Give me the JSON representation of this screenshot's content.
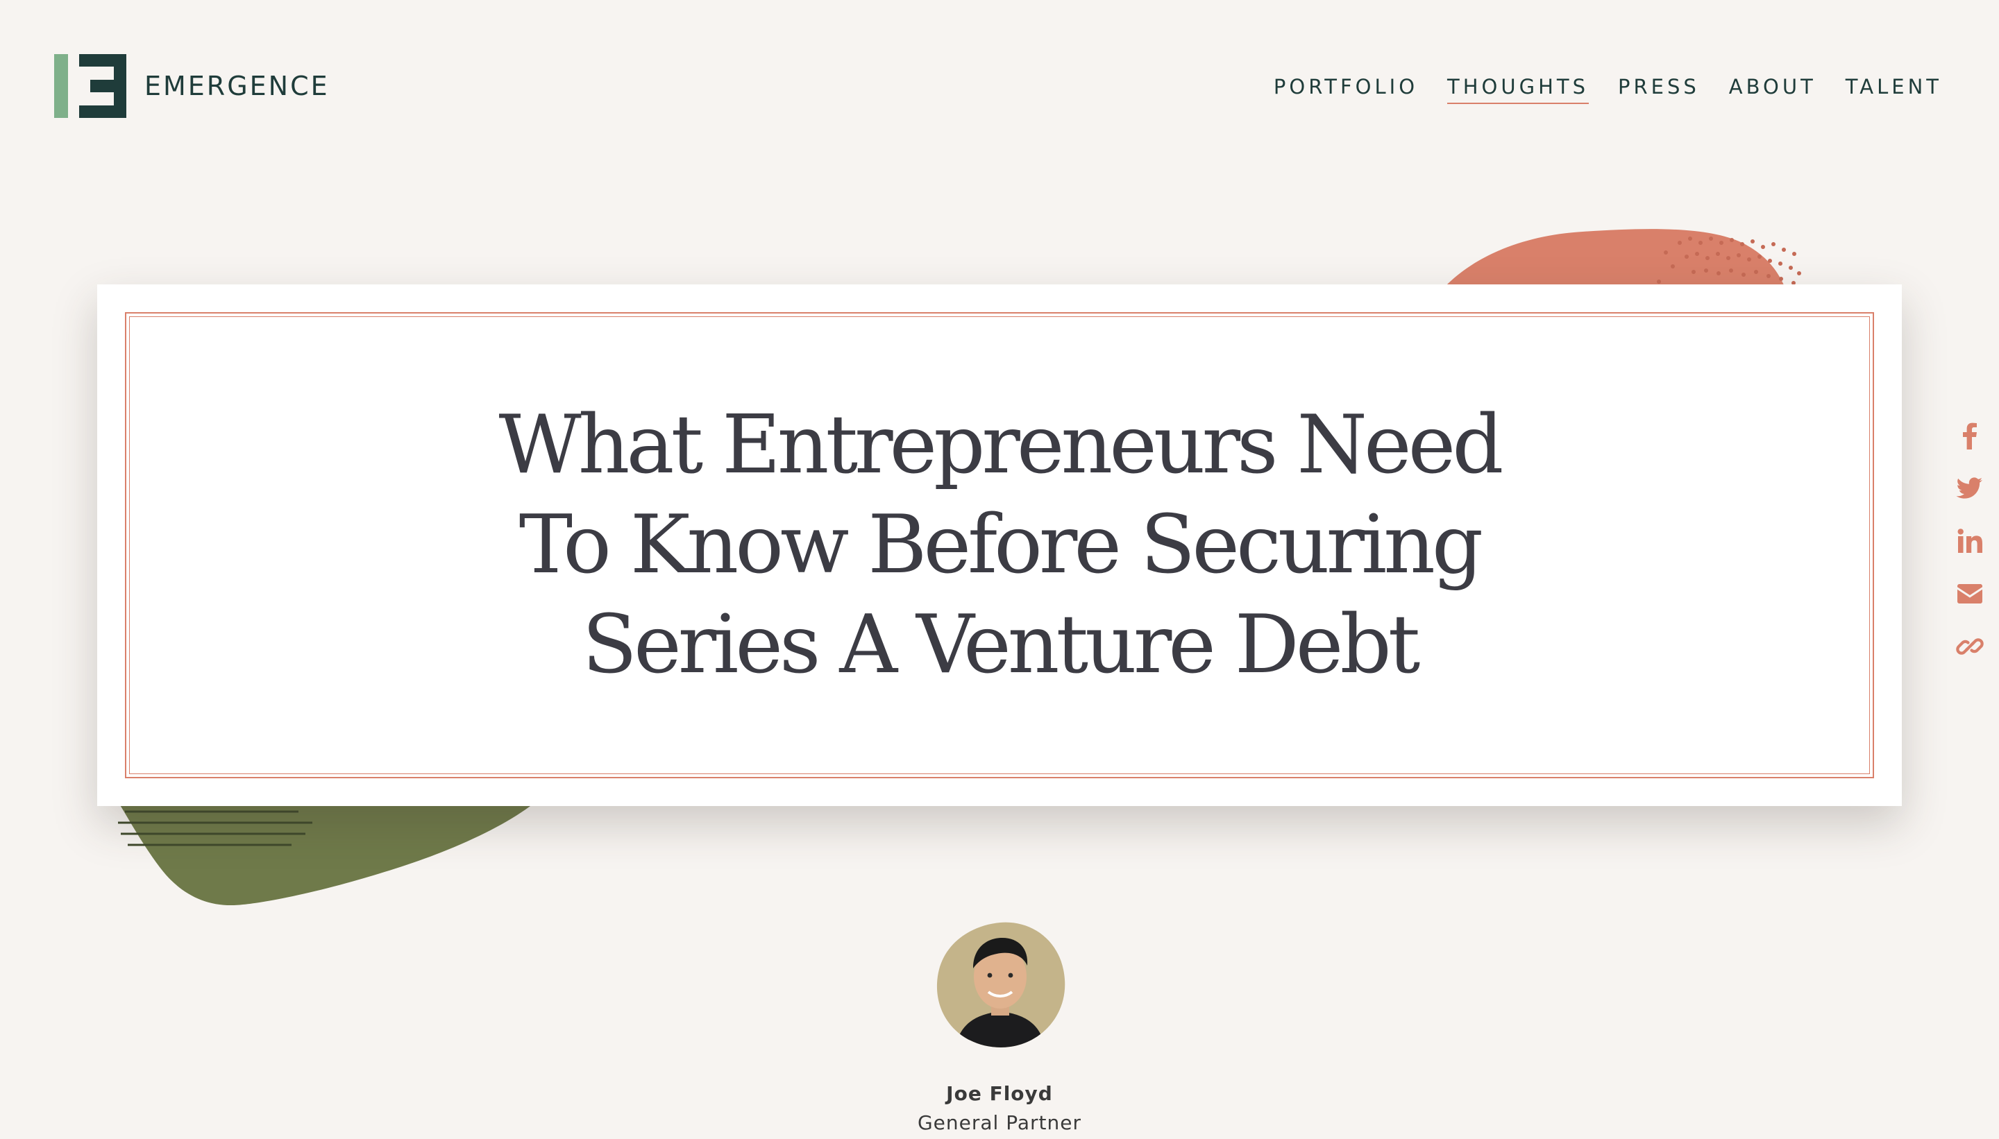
{
  "brand": {
    "name": "EMERGENCE",
    "logo_icon": "emergence-e-logo",
    "colors": {
      "dark_green": "#1f3c3a",
      "light_green": "#7fb08a"
    }
  },
  "nav": {
    "items": [
      {
        "label": "PORTFOLIO",
        "active": false
      },
      {
        "label": "THOUGHTS",
        "active": true
      },
      {
        "label": "PRESS",
        "active": false
      },
      {
        "label": "ABOUT",
        "active": false
      },
      {
        "label": "TALENT",
        "active": false
      }
    ]
  },
  "article": {
    "title": "What Entrepreneurs Need To Know Before Securing Series A Venture Debt"
  },
  "author": {
    "name": "Joe Floyd",
    "role": "General Partner"
  },
  "share": {
    "icons": [
      "facebook-icon",
      "twitter-icon",
      "linkedin-icon",
      "email-icon",
      "link-icon"
    ],
    "color": "#d9806a"
  },
  "colors": {
    "accent": "#d9806a",
    "background": "#f7f4f1",
    "title_text": "#3c3c44",
    "olive": "#6f7a4a"
  }
}
